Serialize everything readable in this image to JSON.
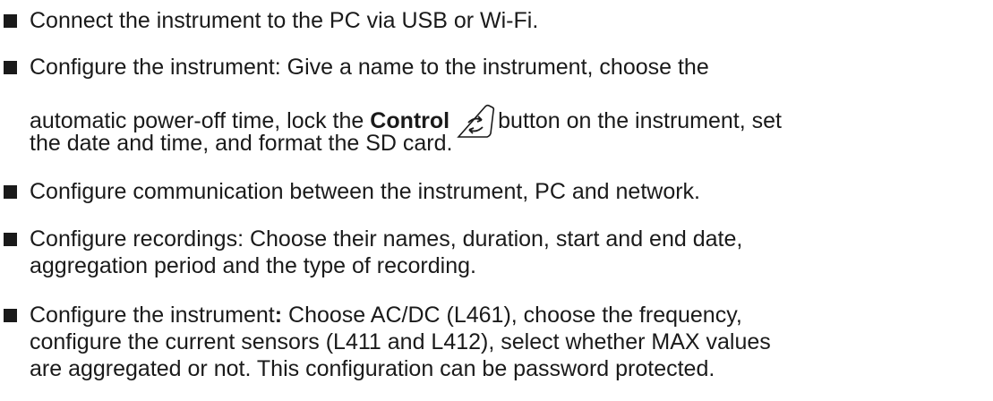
{
  "list": {
    "item1": {
      "line1": "Connect the instrument to the PC via USB or Wi-Fi."
    },
    "item2": {
      "line1": "Configure the instrument: Give a name to the instrument, choose the",
      "line2_pre": "automatic power-off time, lock the ",
      "line2_bold": "Control",
      "line2_post": "button on the instrument, set",
      "line3": "the date and time, and format the SD card.",
      "icon": "control-button-icon"
    },
    "item3": {
      "line1": "Configure communication between the instrument, PC and network."
    },
    "item4": {
      "line1": "Configure recordings: Choose their names, duration, start and end date,",
      "line2": "aggregation period and the type of recording."
    },
    "item5": {
      "line1_pre": "Configure the instrument",
      "line1_bold": ":",
      "line1_post": " Choose AC/DC (L461), choose the frequency,",
      "line2": "configure the current sensors (L411 and L412), select whether MAX values",
      "line3": "are aggregated or not. This configuration can be password protected."
    }
  }
}
